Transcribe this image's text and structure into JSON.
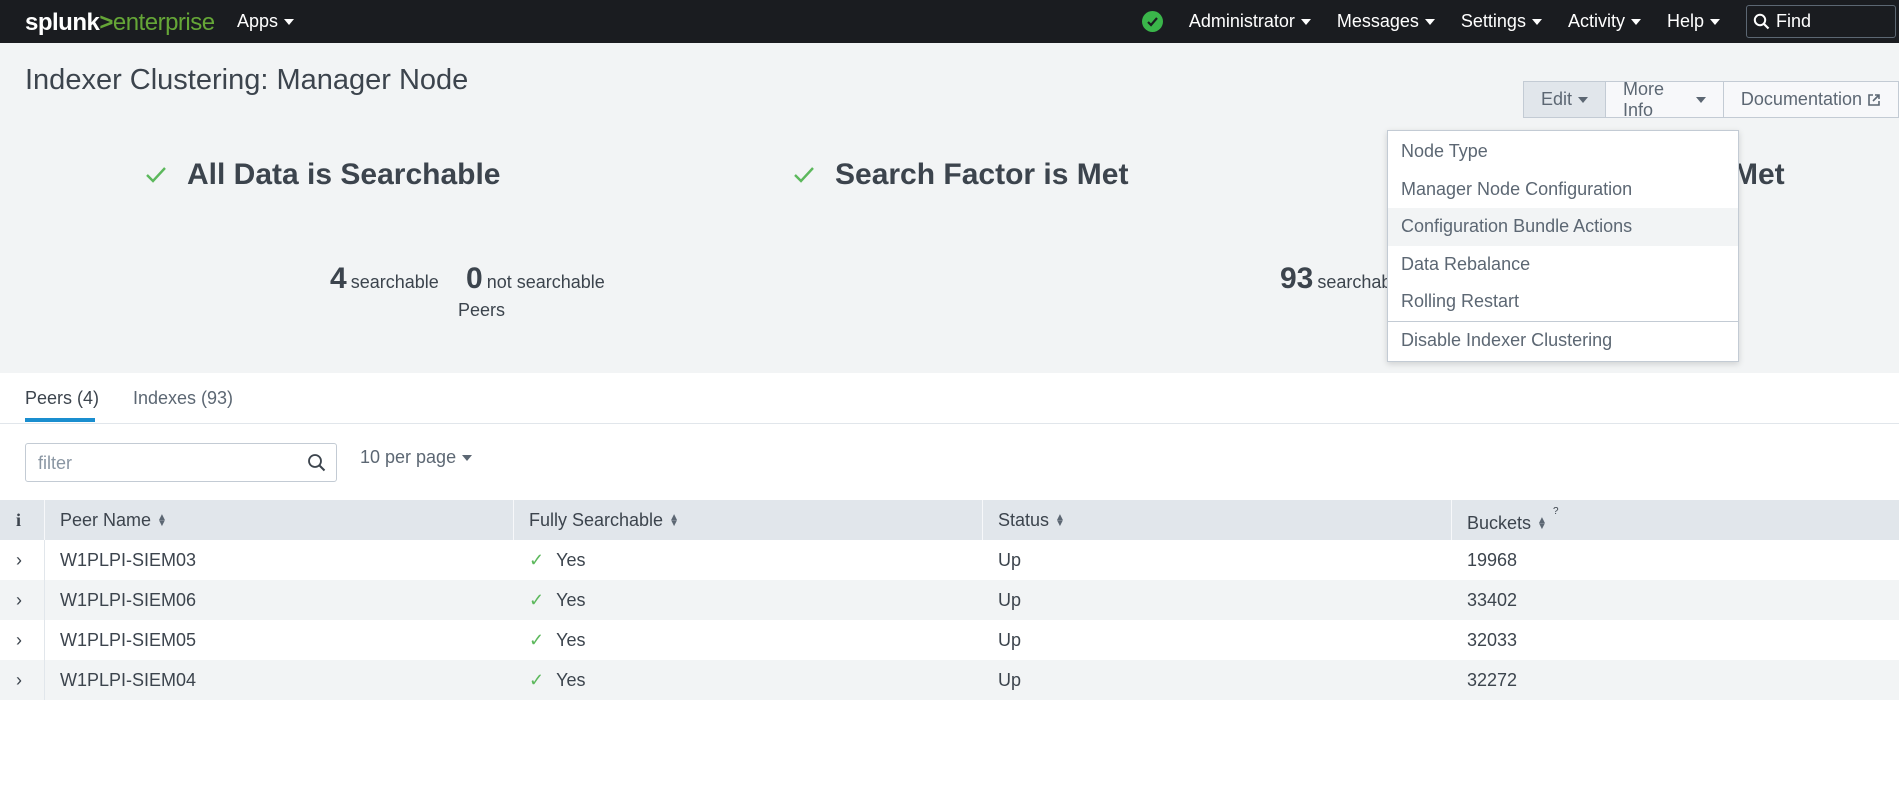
{
  "topbar": {
    "logo_brand": "splunk",
    "logo_sep": ">",
    "logo_product": "enterprise",
    "apps_label": "Apps",
    "nav": [
      "Administrator",
      "Messages",
      "Settings",
      "Activity",
      "Help"
    ],
    "find_label": "Find"
  },
  "page": {
    "title": "Indexer Clustering: Manager Node"
  },
  "actions": {
    "edit_label": "Edit",
    "more_info_label": "More Info",
    "documentation_label": "Documentation"
  },
  "edit_menu": {
    "items": [
      "Node Type",
      "Manager Node Configuration",
      "Configuration Bundle Actions",
      "Data Rebalance",
      "Rolling Restart",
      "Disable Indexer Clustering"
    ],
    "highlighted_index": 2
  },
  "summary": {
    "all_data": "All Data is Searchable",
    "search_factor": "Search Factor is Met",
    "replication_factor_visible": "Met",
    "peers_searchable_value": "4",
    "peers_searchable_label": "searchable",
    "peers_not_searchable_value": "0",
    "peers_not_searchable_label": "not searchable",
    "peers_caption": "Peers",
    "indexes_searchable_value": "93",
    "indexes_searchable_label": "searchab"
  },
  "tabs": [
    {
      "label": "Peers (4)",
      "active": true
    },
    {
      "label": "Indexes (93)",
      "active": false
    }
  ],
  "filter": {
    "placeholder": "filter",
    "per_page": "10 per page"
  },
  "table": {
    "info_header": "i",
    "headers": [
      "Peer Name",
      "Fully Searchable",
      "Status",
      "Buckets"
    ],
    "buckets_help": "?",
    "rows": [
      {
        "peer": "W1PLPI-SIEM03",
        "searchable": "Yes",
        "status": "Up",
        "buckets": "19968"
      },
      {
        "peer": "W1PLPI-SIEM06",
        "searchable": "Yes",
        "status": "Up",
        "buckets": "33402"
      },
      {
        "peer": "W1PLPI-SIEM05",
        "searchable": "Yes",
        "status": "Up",
        "buckets": "32033"
      },
      {
        "peer": "W1PLPI-SIEM04",
        "searchable": "Yes",
        "status": "Up",
        "buckets": "32272"
      }
    ]
  },
  "colors": {
    "topbar_bg": "#1a1c20",
    "brand_green": "#65a637",
    "check_green": "#5cb85c",
    "tab_accent": "#1a8ecf"
  }
}
